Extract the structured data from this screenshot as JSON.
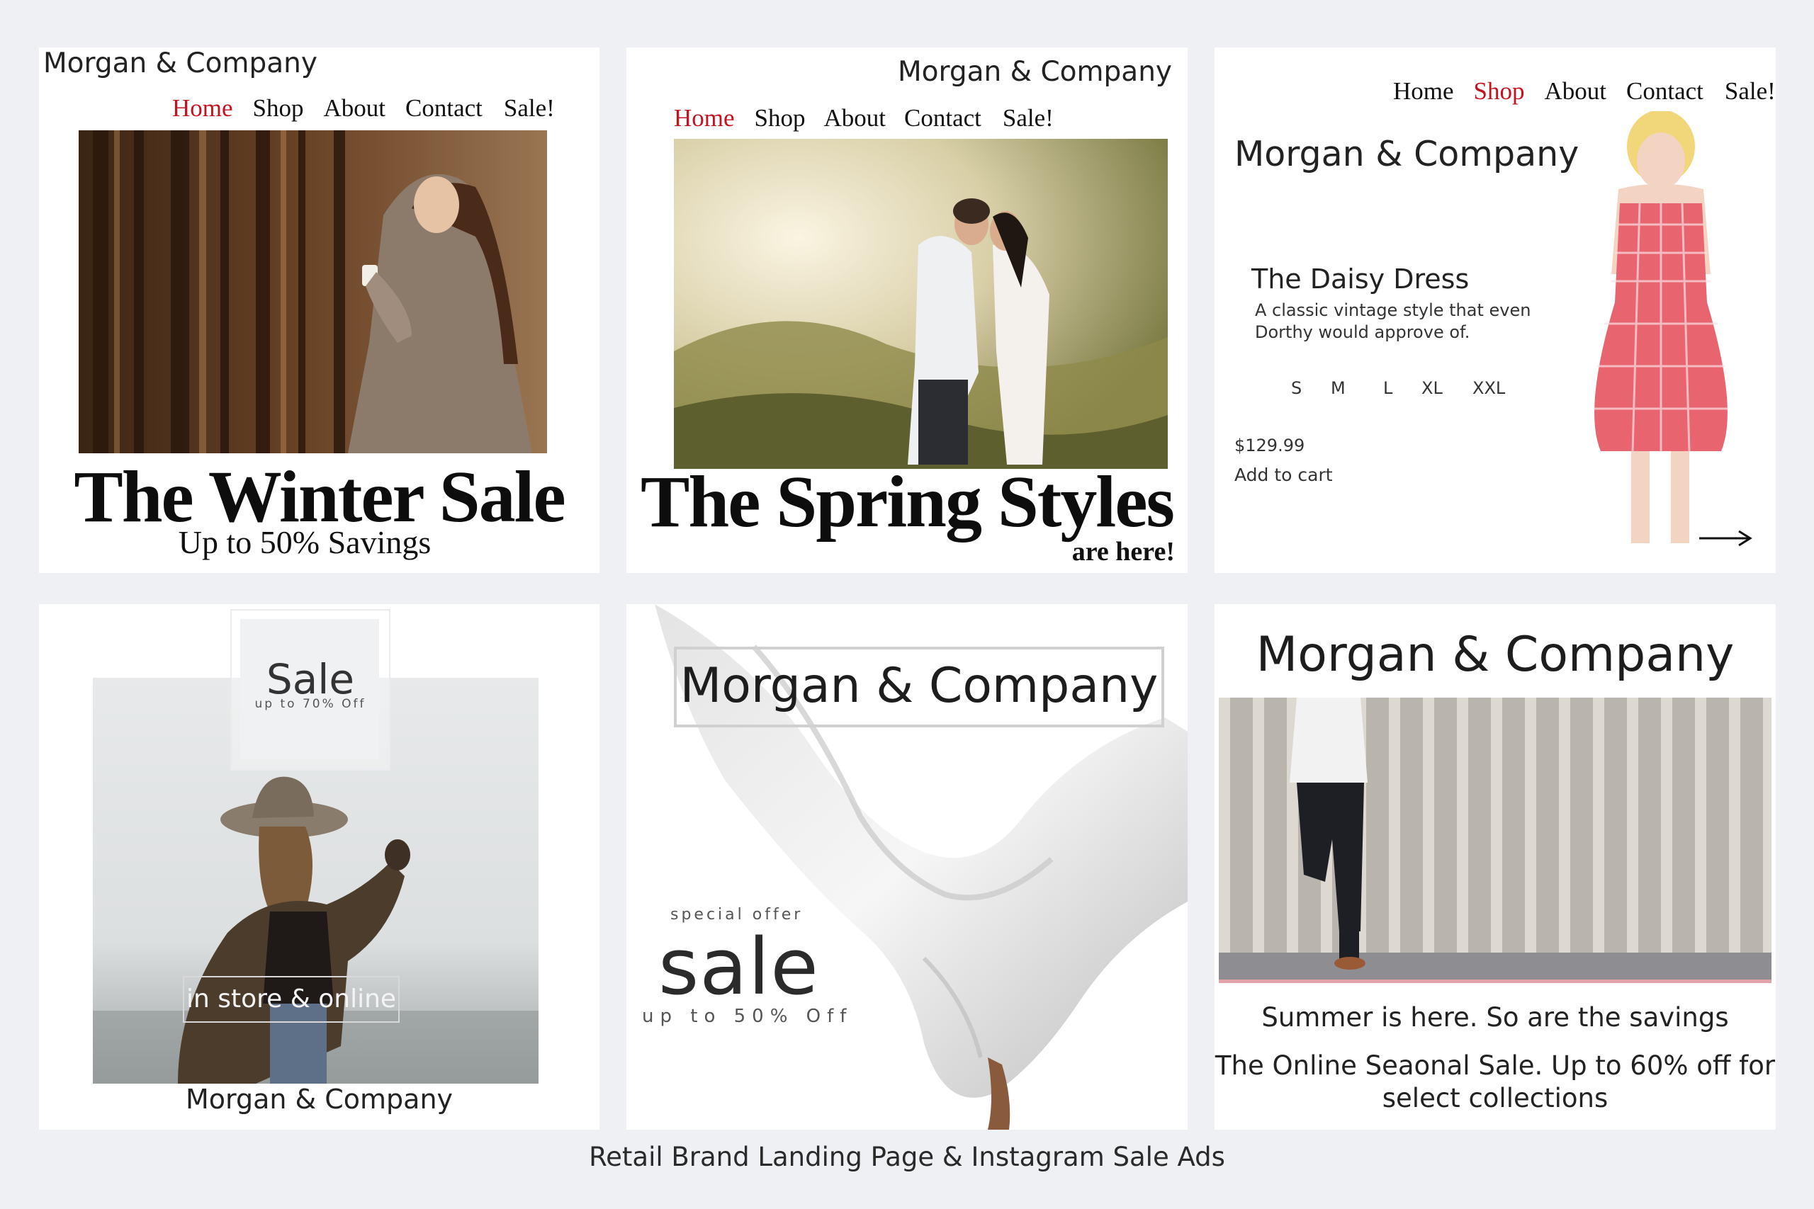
{
  "brand": "Morgan & Company",
  "nav": [
    "Home",
    "Shop",
    "About",
    "Contact",
    "Sale!"
  ],
  "colors": {
    "background": "#eef0f4",
    "accent": "#c41220",
    "text": "#111111",
    "card": "#ffffff"
  },
  "card1": {
    "brand": "Morgan & Company",
    "headline": "The Winter Sale",
    "subhead": "Up to 50% Savings",
    "active_nav": "Home",
    "image": "woman-in-forest-holding-coffee"
  },
  "card2": {
    "brand": "Morgan & Company",
    "headline": "The Spring Styles",
    "subhead": "are here!",
    "active_nav": "Home",
    "image": "couple-kissing-in-sunlit-field"
  },
  "card3": {
    "brand": "Morgan & Company",
    "active_nav": "Shop",
    "product_name": "The Daisy Dress",
    "description_line1": "A classic vintage style that even",
    "description_line2": "Dorthy would approve of.",
    "sizes": [
      "S",
      "M",
      "L",
      "XL",
      "XXL"
    ],
    "price": "$129.99",
    "add_to_cart": "Add to cart",
    "next_icon": "arrow-right-icon",
    "image": "woman-in-red-gingham-dress"
  },
  "card4": {
    "sale_title": "Sale",
    "sale_sub": "up to 70% Off",
    "tag": "in store & online",
    "brand": "Morgan & Company",
    "image": "woman-in-hat-at-shore"
  },
  "card5": {
    "brand": "Morgan & Company",
    "kicker": "special offer",
    "big": "sale",
    "sub": "up to 50% Off",
    "image": "flowing-white-fabric"
  },
  "card6": {
    "brand": "Morgan & Company",
    "line1": "Summer is here. So are the savings",
    "line2a": "The Online Seaonal Sale. Up to 60% off for",
    "line2b": "select collections",
    "image": "man-leaning-on-metal-wall"
  },
  "caption": "Retail Brand  Landing Page & Instagram Sale Ads"
}
